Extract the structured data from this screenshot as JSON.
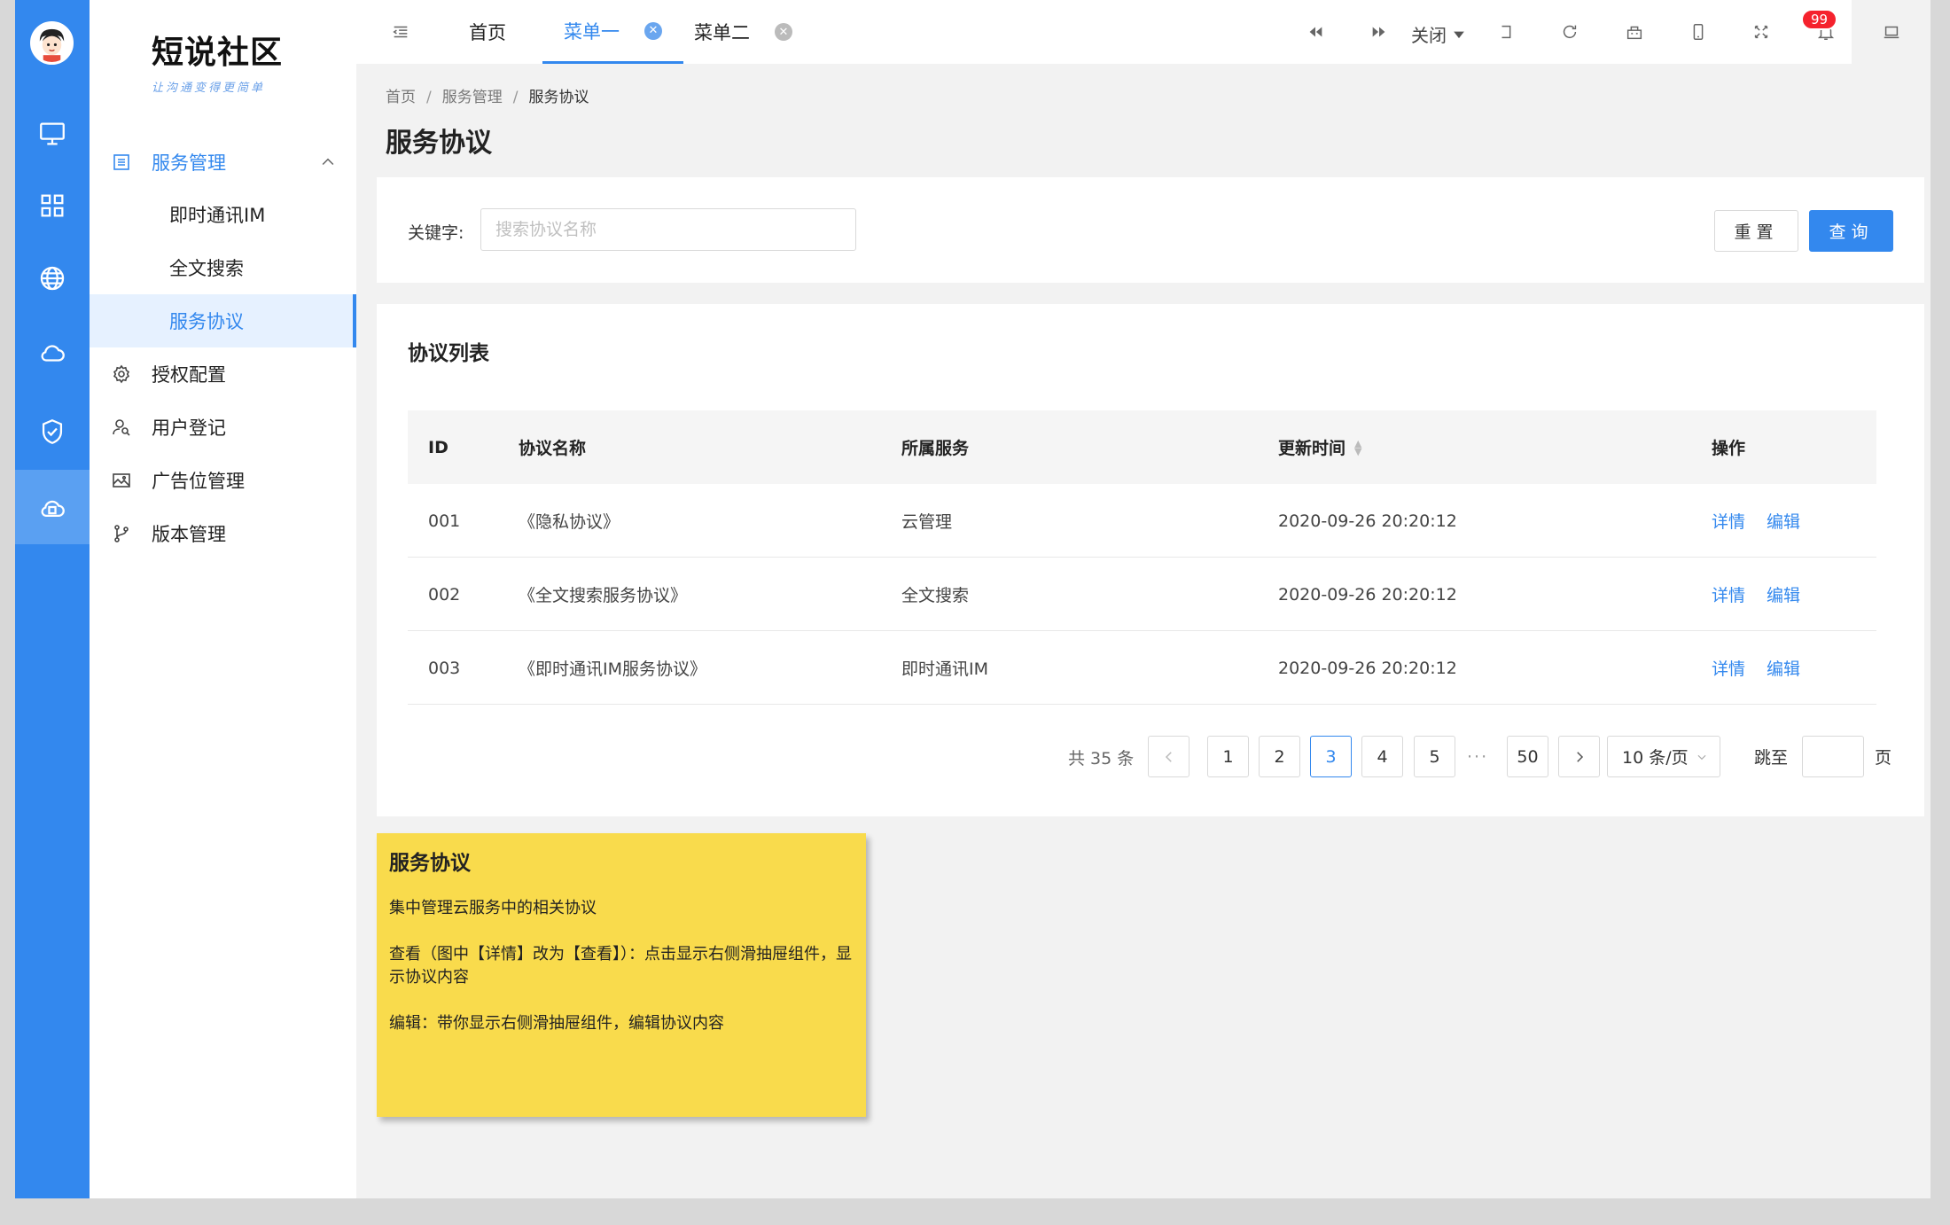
{
  "app": {
    "logo_title": "短说社区",
    "logo_subtitle": "让沟通变得更简单"
  },
  "rail": {
    "items": [
      "monitor-icon",
      "grid-icon",
      "globe-icon",
      "cloud-icon",
      "shield-check-icon",
      "cloud-server-icon"
    ]
  },
  "sidebar": {
    "group": "服务管理",
    "sub_items": [
      "即时通讯IM",
      "全文搜索",
      "服务协议"
    ],
    "items": [
      "授权配置",
      "用户登记",
      "广告位管理",
      "版本管理"
    ]
  },
  "tabs": [
    {
      "label": "首页"
    },
    {
      "label": "菜单一"
    },
    {
      "label": "菜单二"
    }
  ],
  "topbar": {
    "close_label": "关闭",
    "notify_count": "99"
  },
  "breadcrumb": {
    "home": "首页",
    "section": "服务管理",
    "current": "服务协议",
    "sep": "/"
  },
  "page": {
    "title": "服务协议"
  },
  "search": {
    "label": "关键字:",
    "placeholder": "搜索协议名称",
    "reset": "重置",
    "query": "查询"
  },
  "list": {
    "title": "协议列表",
    "columns": {
      "id": "ID",
      "name": "协议名称",
      "service": "所属服务",
      "updated": "更新时间",
      "ops": "操作"
    },
    "rows": [
      {
        "id": "001",
        "name": "《隐私协议》",
        "service": "云管理",
        "updated": "2020-09-26 20:20:12",
        "detail": "详情",
        "edit": "编辑"
      },
      {
        "id": "002",
        "name": "《全文搜索服务协议》",
        "service": "全文搜索",
        "updated": "2020-09-26 20:20:12",
        "detail": "详情",
        "edit": "编辑"
      },
      {
        "id": "003",
        "name": "《即时通讯IM服务协议》",
        "service": "即时通讯IM",
        "updated": "2020-09-26 20:20:12",
        "detail": "详情",
        "edit": "编辑"
      }
    ]
  },
  "pagination": {
    "total": "共 35 条",
    "pages": [
      "1",
      "2",
      "3",
      "4",
      "5"
    ],
    "current": "3",
    "ellipsis": "···",
    "last": "50",
    "page_size": "10 条/页",
    "jump_label": "跳至",
    "page_unit": "页"
  },
  "note": {
    "title": "服务协议",
    "lines": [
      "集中管理云服务中的相关协议",
      "查看（图中【详情】改为【查看】）：点击显示右侧滑抽屉组件，显示协议内容",
      "编辑：带你显示右侧滑抽屉组件，编辑协议内容"
    ]
  },
  "colors": {
    "primary": "#3388ee",
    "rail": "#3388ee",
    "note": "#f9db4c",
    "badge": "#f5222d"
  }
}
